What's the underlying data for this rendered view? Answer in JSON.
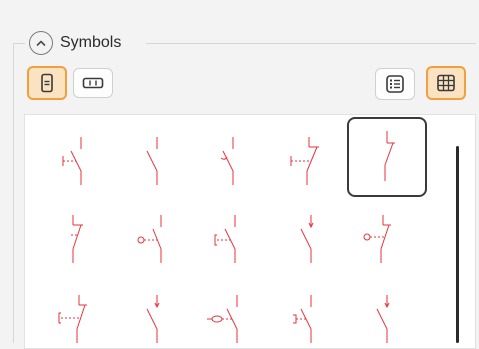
{
  "group": {
    "title": "Symbols",
    "collapse_icon": "chevron-up-circle-icon"
  },
  "toolbar": {
    "orientation_vertical_icon": "vertical-orientation-icon",
    "orientation_horizontal_icon": "horizontal-orientation-icon",
    "list_view_icon": "list-view-icon",
    "grid_view_icon": "grid-view-icon",
    "active_orientation": "vertical",
    "active_view": "grid"
  },
  "colors": {
    "accent_fill": "#fbe3c2",
    "accent_border": "#f0a040",
    "symbol_stroke": "#e8323c",
    "selection_border": "#3a3a3a"
  },
  "symbols": [
    {
      "icon": "switch-no-manual-icon"
    },
    {
      "icon": "switch-no-icon"
    },
    {
      "icon": "switch-no-delayed-icon"
    },
    {
      "icon": "switch-nc-manual-icon"
    },
    {
      "icon": "switch-nc-icon",
      "selected": true
    },
    {
      "icon": "switch-nc-stem-icon"
    },
    {
      "icon": "switch-no-roller-icon"
    },
    {
      "icon": "switch-no-pull-icon"
    },
    {
      "icon": "switch-no-arrow-icon"
    },
    {
      "icon": "switch-nc-roller-icon"
    },
    {
      "icon": "switch-nc-pull-icon"
    },
    {
      "icon": "switch-no-arrow-2-icon"
    },
    {
      "icon": "switch-no-oval-icon"
    },
    {
      "icon": "switch-no-key-icon"
    },
    {
      "icon": "switch-no-arrow-3-icon"
    }
  ]
}
